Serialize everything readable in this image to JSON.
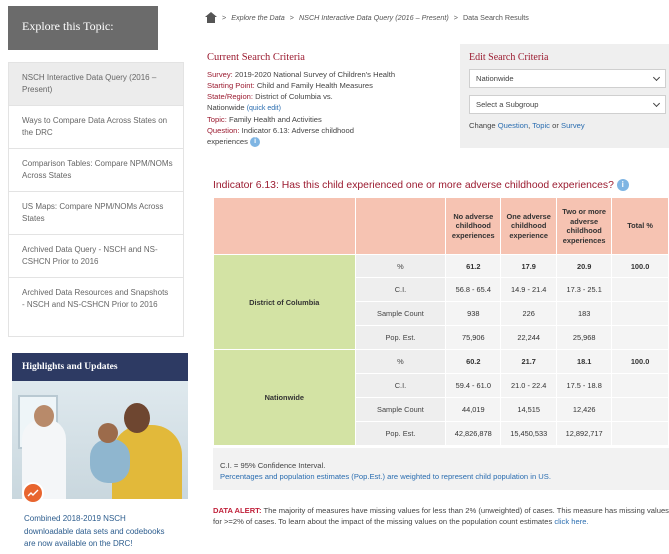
{
  "sidebar": {
    "topic_title": "Explore this Topic:",
    "items": [
      {
        "label": "NSCH Interactive Data Query (2016 – Present)"
      },
      {
        "label": "Ways to Compare Data Across States on the DRC"
      },
      {
        "label": "Comparison Tables: Compare NPM/NOMs Across States"
      },
      {
        "label": "US Maps: Compare NPM/NOMs Across States"
      },
      {
        "label": "Archived Data Query - NSCH and NS-CSHCN Prior to 2016"
      },
      {
        "label": "Archived Data Resources and Snapshots - NSCH and NS-CSHCN Prior to 2016"
      }
    ],
    "highlights_title": "Highlights and Updates",
    "highlights_text": "Combined 2018-2019 NSCH downloadable data sets and codebooks are now available on the DRC!"
  },
  "breadcrumb": {
    "item1": "Explore the Data",
    "item2": "NSCH Interactive Data Query (2016 – Present)",
    "current": "Data Search Results",
    "sep": ">"
  },
  "current_criteria": {
    "title": "Current Search Criteria",
    "survey_label": "Survey:",
    "survey_value": "2019-2020 National Survey of Children's Health",
    "start_label": "Starting Point:",
    "start_value": "Child and Family Health Measures",
    "state_label": "State/Region:",
    "state_value": "District of Columbia vs.",
    "state_value2": "Nationwide",
    "quick_edit": "(quick edit)",
    "topic_label": "Topic:",
    "topic_value": "Family Health and Activities",
    "question_label": "Question:",
    "question_value": "Indicator 6.13: Adverse childhood",
    "question_value2": "experiences"
  },
  "edit_criteria": {
    "title": "Edit Search Criteria",
    "region_select": "Nationwide",
    "subgroup_select": "Select a Subgroup",
    "change_prefix": "Change",
    "change_question": "Question",
    "change_comma": ",",
    "change_topic": "Topic",
    "change_or": "or",
    "change_survey": "Survey"
  },
  "indicator": {
    "title": "Indicator 6.13: Has this child experienced one or more adverse childhood experiences?"
  },
  "table": {
    "headers": [
      "No adverse childhood experiences",
      "One adverse childhood experience",
      "Two or more adverse childhood experiences",
      "Total %"
    ],
    "groups": [
      {
        "name": "District of Columbia",
        "rows": [
          {
            "label": "%",
            "values": [
              "61.2",
              "17.9",
              "20.9",
              "100.0"
            ]
          },
          {
            "label": "C.I.",
            "values": [
              "56.8 - 65.4",
              "14.9 - 21.4",
              "17.3 - 25.1",
              ""
            ]
          },
          {
            "label": "Sample Count",
            "values": [
              "938",
              "226",
              "183",
              ""
            ]
          },
          {
            "label": "Pop. Est.",
            "values": [
              "75,906",
              "22,244",
              "25,968",
              ""
            ]
          }
        ]
      },
      {
        "name": "Nationwide",
        "rows": [
          {
            "label": "%",
            "values": [
              "60.2",
              "21.7",
              "18.1",
              "100.0"
            ]
          },
          {
            "label": "C.I.",
            "values": [
              "59.4 - 61.0",
              "21.0 - 22.4",
              "17.5 - 18.8",
              ""
            ]
          },
          {
            "label": "Sample Count",
            "values": [
              "44,019",
              "14,515",
              "12,426",
              ""
            ]
          },
          {
            "label": "Pop. Est.",
            "values": [
              "42,826,878",
              "15,450,533",
              "12,892,717",
              ""
            ]
          }
        ]
      }
    ]
  },
  "notes": {
    "ci": "C.I. = 95% Confidence Interval.",
    "pop": "Percentages and population estimates (Pop.Est.) are weighted to represent child population in US."
  },
  "alert": {
    "label": "DATA ALERT:",
    "text": "The majority of measures have missing values for less than 2% (unweighted) of cases. This measure has missing values for >=2% of cases. To learn about the impact of the missing values on the population count estimates",
    "link": "click here."
  },
  "colors": {
    "accent_red": "#9b1b30",
    "link_blue": "#2a6db0",
    "header_salmon": "#f6c3b2",
    "group_green": "#d3e3a4",
    "highlights_navy": "#2d3a63"
  }
}
